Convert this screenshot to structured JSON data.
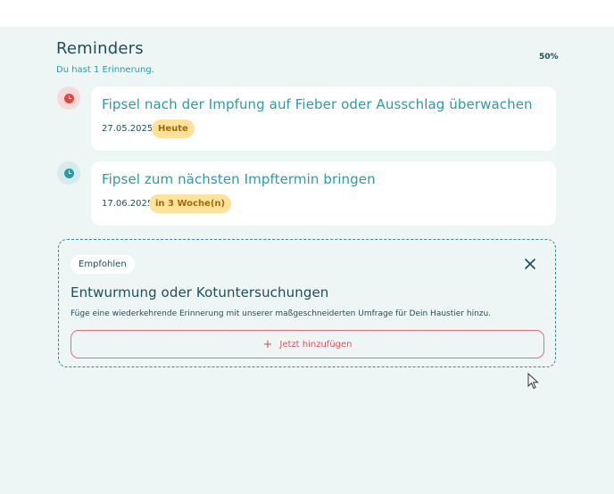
{
  "header": {
    "title": "Reminders",
    "subtitle": "Du hast 1 Erinnerung.",
    "progress": "50%"
  },
  "reminders": [
    {
      "title": "Fipsel nach der Impfung auf Fieber oder Ausschlag überwachen",
      "date": "27.05.2025",
      "badge": "Heute",
      "icon": "clock-icon",
      "icon_color": "#e5453e"
    },
    {
      "title": "Fipsel zum nächsten Impftermin bringen",
      "date": "17.06.2025",
      "badge": "in 3 Woche(n)",
      "icon": "clock-icon",
      "icon_color": "#2e9aa6"
    }
  ],
  "recommendation": {
    "tag": "Empfohlen",
    "title": "Entwurmung oder Kotuntersuchungen",
    "description": "Füge eine wiederkehrende Erinnerung mit unserer maßgeschneiderten Umfrage für Dein Haustier hinzu.",
    "button_label": "Jetzt hinzufügen"
  },
  "colors": {
    "accent_teal": "#2e9aa6",
    "dark_teal": "#1e4f57",
    "badge_yellow": "#fde29a",
    "button_red": "#e5535a",
    "background": "#eef5f5"
  }
}
